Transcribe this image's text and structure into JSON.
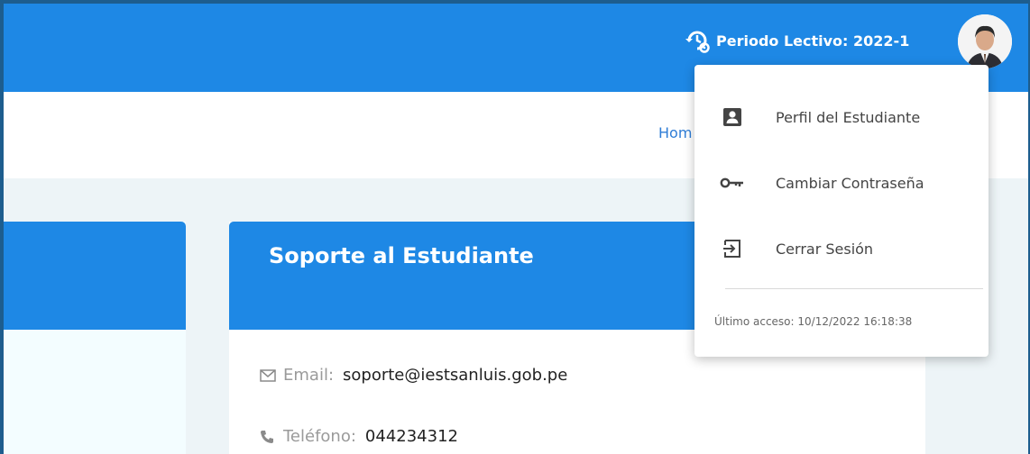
{
  "header": {
    "period_label": "Periodo Lectivo: 2022-1",
    "period_icon": "history-gear-icon",
    "avatar": "user-avatar"
  },
  "breadcrumb": {
    "home": "Hom"
  },
  "support_card": {
    "title": "Soporte al Estudiante",
    "email_label": "Email:",
    "email_value": "soporte@iestsanluis.gob.pe",
    "phone_label": "Teléfono:",
    "phone_value": "044234312"
  },
  "user_menu": {
    "items": [
      {
        "label": "Perfil del Estudiante",
        "icon": "profile-icon"
      },
      {
        "label": "Cambiar Contraseña",
        "icon": "key-icon"
      },
      {
        "label": "Cerrar Sesión",
        "icon": "logout-icon"
      }
    ],
    "last_access": "Último acceso: 10/12/2022 16:18:38"
  },
  "colors": {
    "primary": "#1e88e5",
    "frame": "#1d5d8e",
    "background": "#edf4f7"
  }
}
